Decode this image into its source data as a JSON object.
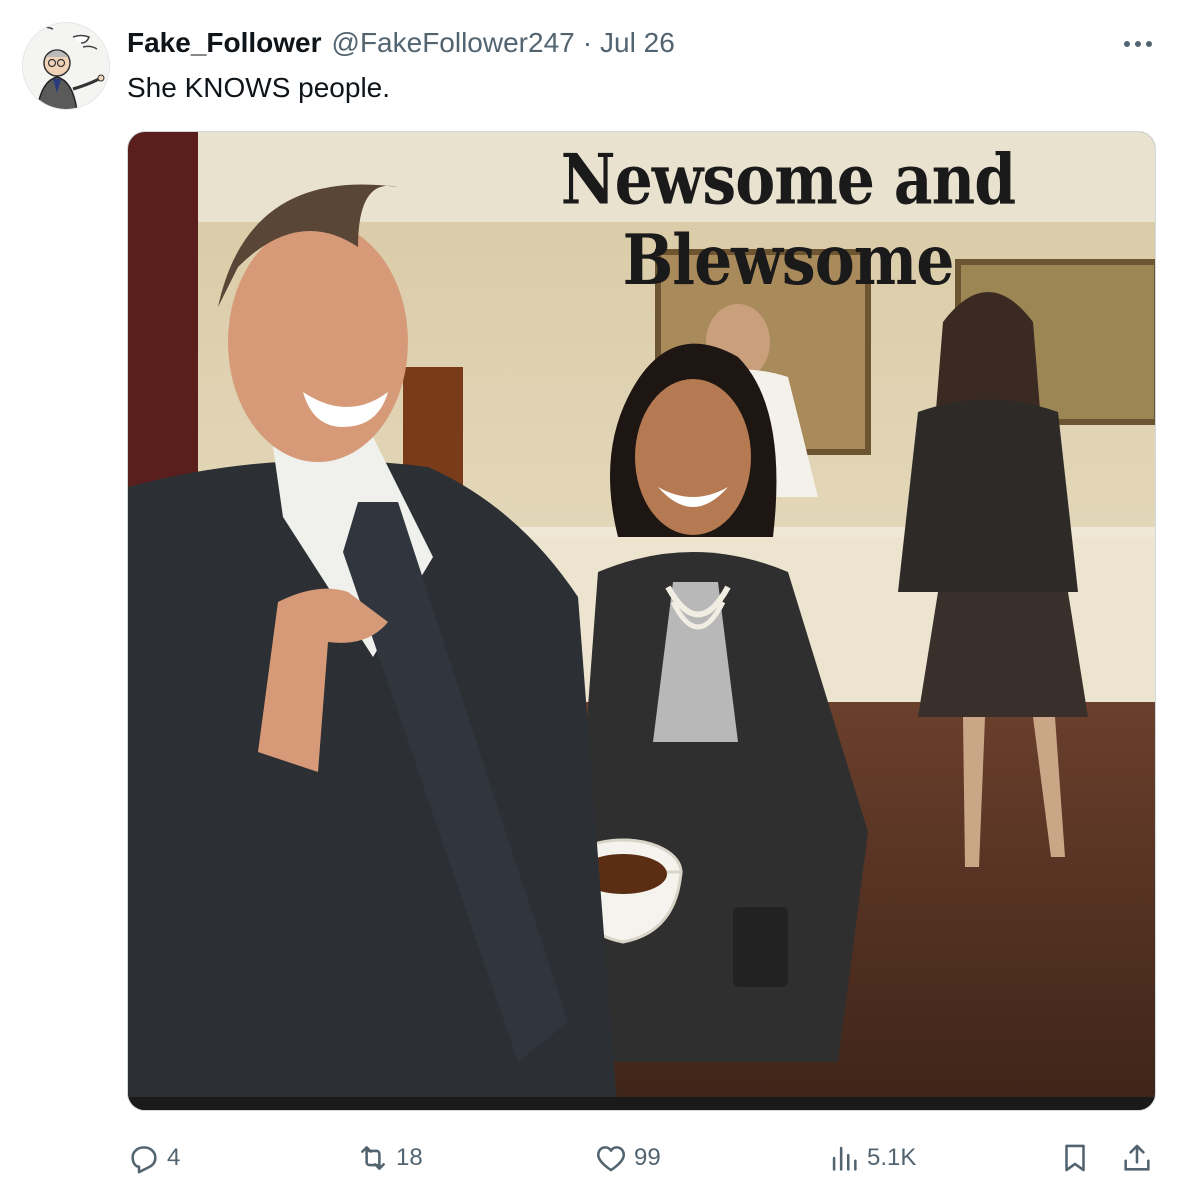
{
  "tweet": {
    "display_name": "Fake_Follower",
    "handle": "@FakeFollower247",
    "separator": "·",
    "date": "Jul 26",
    "text": "She KNOWS people.",
    "more_icon": "more-horizontal-icon"
  },
  "media": {
    "caption_text": "Newsome and Blewsome"
  },
  "actions": {
    "replies": "4",
    "retweets": "18",
    "likes": "99",
    "views": "5.1K"
  },
  "colors": {
    "text_primary": "#0f1419",
    "text_secondary": "#536471",
    "border": "#cfd9de"
  }
}
